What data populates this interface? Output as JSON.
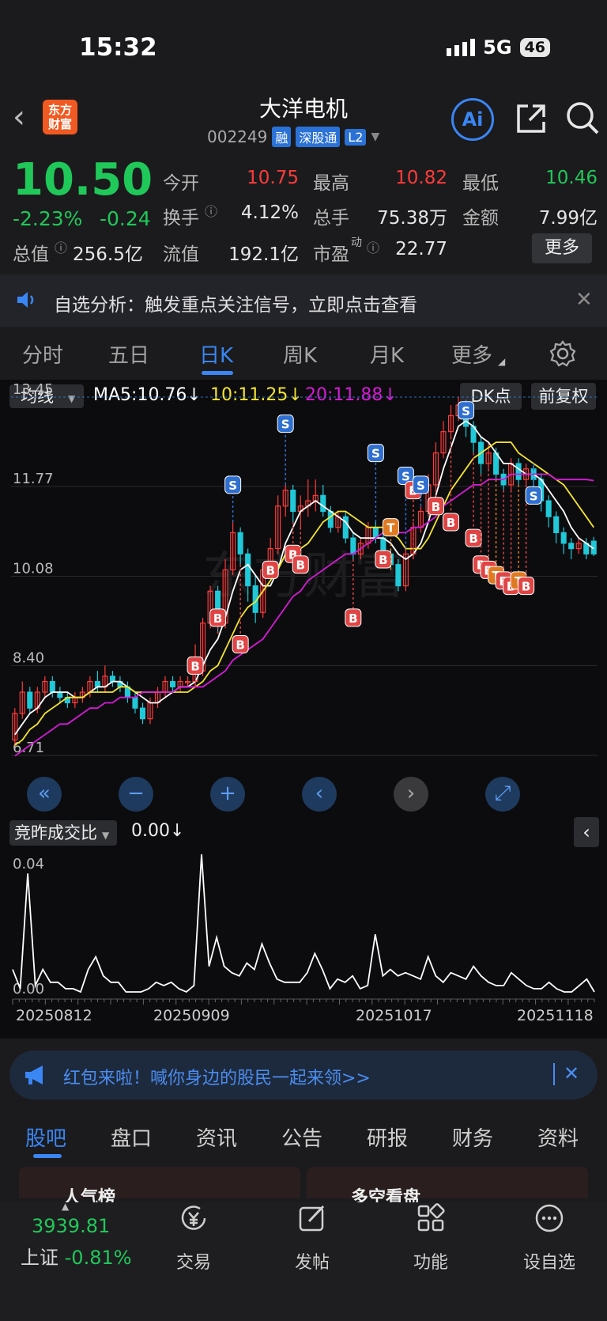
{
  "status": {
    "time": "15:32",
    "network": "5G",
    "battery": "46"
  },
  "header": {
    "logo": "东方\n财富",
    "title": "大洋电机",
    "code": "002249",
    "tags": [
      "融",
      "深股通",
      "L2"
    ],
    "ai_label": "Ai"
  },
  "quote": {
    "price": "10.50",
    "change_pct": "-2.23%",
    "change": "-0.24",
    "open_label": "今开",
    "open": "10.75",
    "high_label": "最高",
    "high": "10.82",
    "low_label": "最低",
    "low": "10.46",
    "turnover_label": "换手",
    "turnover": "4.12%",
    "volume_label": "总手",
    "volume": "75.38万",
    "amount_label": "金额",
    "amount": "7.99亿",
    "mcap_label": "总值",
    "mcap": "256.5亿",
    "float_label": "流值",
    "float": "192.1亿",
    "pe_label": "市盈",
    "pe_sup": "动",
    "pe": "22.77",
    "more": "更多"
  },
  "notice": {
    "text": "自选分析：触发重点关注信号，立即点击查看"
  },
  "tabs": [
    "分时",
    "五日",
    "日K",
    "周K",
    "月K",
    "更多"
  ],
  "active_tab": "日K",
  "chart_header": {
    "ma_select": "均线",
    "ma5": "MA5:10.76↓",
    "ma10": "10:11.25↓",
    "ma20": "20:11.88↓",
    "dk": "DK点",
    "fq": "前复权"
  },
  "colors": {
    "up": "#ff3b3b",
    "down": "#20c8d8",
    "ma5": "#ffffff",
    "ma10": "#f5e52a",
    "ma20": "#d81ad8",
    "accent": "#3a86f4",
    "green": "#20c85a"
  },
  "chart_data": {
    "type": "candlestick",
    "price_axis_labels": [
      "13.45",
      "11.77",
      "10.08",
      "8.40",
      "6.71"
    ],
    "ylim": [
      6.71,
      13.45
    ],
    "candles": [
      [
        7.0,
        7.5,
        6.9,
        7.6
      ],
      [
        7.5,
        7.9,
        7.4,
        8.1
      ],
      [
        7.9,
        7.6,
        7.5,
        8.0
      ],
      [
        7.6,
        7.9,
        7.5,
        8.0
      ],
      [
        7.9,
        8.1,
        7.8,
        8.2
      ],
      [
        8.1,
        7.9,
        7.8,
        8.2
      ],
      [
        7.9,
        7.8,
        7.7,
        8.0
      ],
      [
        7.8,
        7.7,
        7.6,
        7.9
      ],
      [
        7.7,
        7.8,
        7.6,
        7.9
      ],
      [
        7.8,
        7.9,
        7.7,
        8.0
      ],
      [
        7.9,
        8.1,
        7.8,
        8.2
      ],
      [
        8.1,
        8.0,
        7.9,
        8.3
      ],
      [
        8.0,
        8.2,
        7.9,
        8.4
      ],
      [
        8.2,
        8.1,
        8.0,
        8.3
      ],
      [
        8.1,
        8.0,
        7.9,
        8.2
      ],
      [
        8.0,
        7.8,
        7.7,
        8.1
      ],
      [
        7.8,
        7.6,
        7.5,
        7.9
      ],
      [
        7.6,
        7.4,
        7.3,
        7.7
      ],
      [
        7.4,
        7.7,
        7.3,
        7.8
      ],
      [
        7.7,
        7.9,
        7.6,
        8.0
      ],
      [
        7.9,
        8.1,
        7.8,
        8.2
      ],
      [
        8.1,
        8.0,
        7.9,
        8.2
      ],
      [
        8.0,
        8.1,
        7.9,
        8.2
      ],
      [
        8.1,
        8.1,
        8.0,
        8.2
      ],
      [
        8.1,
        8.3,
        8.0,
        8.8
      ],
      [
        8.3,
        9.2,
        8.2,
        9.3
      ],
      [
        9.2,
        9.8,
        9.1,
        9.9
      ],
      [
        9.8,
        9.2,
        9.0,
        9.9
      ],
      [
        9.2,
        10.2,
        9.1,
        10.4
      ],
      [
        10.2,
        10.9,
        10.1,
        11.1
      ],
      [
        10.9,
        10.5,
        10.3,
        11.0
      ],
      [
        10.5,
        9.9,
        9.6,
        10.6
      ],
      [
        9.9,
        9.4,
        9.2,
        10.1
      ],
      [
        9.4,
        10.2,
        9.3,
        10.3
      ],
      [
        10.2,
        10.6,
        10.1,
        10.8
      ],
      [
        10.6,
        11.4,
        10.5,
        11.6
      ],
      [
        11.4,
        11.7,
        11.2,
        11.8
      ],
      [
        11.7,
        11.3,
        11.1,
        11.8
      ],
      [
        11.3,
        11.4,
        11.0,
        11.6
      ],
      [
        11.4,
        11.5,
        11.2,
        11.9
      ],
      [
        11.5,
        11.6,
        11.3,
        11.9
      ],
      [
        11.6,
        11.3,
        11.2,
        11.8
      ],
      [
        11.3,
        11.0,
        10.9,
        11.4
      ],
      [
        11.0,
        11.2,
        10.9,
        11.3
      ],
      [
        11.2,
        10.8,
        10.7,
        11.3
      ],
      [
        10.8,
        10.5,
        10.4,
        10.9
      ],
      [
        10.5,
        10.7,
        10.4,
        10.8
      ],
      [
        10.7,
        11.0,
        10.6,
        11.1
      ],
      [
        11.0,
        10.8,
        10.7,
        11.1
      ],
      [
        10.8,
        10.5,
        10.4,
        10.9
      ],
      [
        10.5,
        10.3,
        10.2,
        10.6
      ],
      [
        10.3,
        9.9,
        9.8,
        10.4
      ],
      [
        9.9,
        10.5,
        9.8,
        10.6
      ],
      [
        10.5,
        11.0,
        10.4,
        11.1
      ],
      [
        11.0,
        11.3,
        10.9,
        11.4
      ],
      [
        11.3,
        11.8,
        11.2,
        12.0
      ],
      [
        11.8,
        12.4,
        11.7,
        12.6
      ],
      [
        12.4,
        12.8,
        12.3,
        13.0
      ],
      [
        12.8,
        13.1,
        12.7,
        13.3
      ],
      [
        13.1,
        13.3,
        13.0,
        13.45
      ],
      [
        13.3,
        12.9,
        12.7,
        13.4
      ],
      [
        12.9,
        12.6,
        12.4,
        13.0
      ],
      [
        12.6,
        12.2,
        12.0,
        12.7
      ],
      [
        12.2,
        12.4,
        12.1,
        12.6
      ],
      [
        12.4,
        12.0,
        11.9,
        12.5
      ],
      [
        12.0,
        11.8,
        11.7,
        12.1
      ],
      [
        11.8,
        12.2,
        11.7,
        12.3
      ],
      [
        12.2,
        11.9,
        11.8,
        12.3
      ],
      [
        11.9,
        12.1,
        11.8,
        12.2
      ],
      [
        12.1,
        11.9,
        11.7,
        12.2
      ],
      [
        11.9,
        11.5,
        11.3,
        12.0
      ],
      [
        11.5,
        11.2,
        11.0,
        11.6
      ],
      [
        11.2,
        10.9,
        10.7,
        11.3
      ],
      [
        10.9,
        10.7,
        10.5,
        11.0
      ],
      [
        10.7,
        10.6,
        10.4,
        10.8
      ],
      [
        10.6,
        10.7,
        10.5,
        10.8
      ],
      [
        10.7,
        10.5,
        10.4,
        10.8
      ],
      [
        10.74,
        10.5,
        10.46,
        10.82
      ]
    ],
    "ma5": [
      7.1,
      7.3,
      7.5,
      7.6,
      7.8,
      7.9,
      7.9,
      7.9,
      7.8,
      7.8,
      7.9,
      8.0,
      8.0,
      8.1,
      8.1,
      8.0,
      7.9,
      7.8,
      7.7,
      7.7,
      7.8,
      7.9,
      8.0,
      8.0,
      8.1,
      8.4,
      8.7,
      8.9,
      9.3,
      9.8,
      10.2,
      10.3,
      10.1,
      9.9,
      9.9,
      10.2,
      10.7,
      11.0,
      11.3,
      11.4,
      11.5,
      11.4,
      11.3,
      11.2,
      11.1,
      10.9,
      10.8,
      10.8,
      10.8,
      10.8,
      10.7,
      10.5,
      10.4,
      10.5,
      10.7,
      11.1,
      11.6,
      12.1,
      12.5,
      12.9,
      13.0,
      12.9,
      12.7,
      12.6,
      12.4,
      12.2,
      12.2,
      12.1,
      12.0,
      12.0,
      11.9,
      11.7,
      11.5,
      11.3,
      11.0,
      10.8,
      10.7,
      10.6
    ],
    "ma10": [
      6.9,
      7.0,
      7.2,
      7.3,
      7.5,
      7.6,
      7.7,
      7.8,
      7.8,
      7.8,
      7.9,
      7.9,
      7.9,
      7.9,
      8.0,
      8.0,
      7.9,
      7.9,
      7.9,
      7.9,
      7.9,
      7.9,
      7.9,
      7.9,
      8.0,
      8.1,
      8.3,
      8.4,
      8.7,
      9.0,
      9.3,
      9.5,
      9.6,
      9.8,
      10.0,
      10.2,
      10.5,
      10.6,
      10.6,
      10.7,
      10.9,
      11.1,
      11.2,
      11.3,
      11.3,
      11.2,
      11.1,
      11.0,
      11.0,
      11.0,
      10.9,
      10.8,
      10.6,
      10.6,
      10.6,
      10.8,
      11.1,
      11.4,
      11.7,
      11.9,
      12.1,
      12.3,
      12.4,
      12.5,
      12.6,
      12.6,
      12.6,
      12.4,
      12.3,
      12.2,
      12.1,
      12.0,
      11.9,
      11.8,
      11.6,
      11.4,
      11.2,
      11.0
    ],
    "ma20": [
      6.7,
      6.8,
      6.9,
      7.0,
      7.1,
      7.2,
      7.3,
      7.3,
      7.4,
      7.5,
      7.6,
      7.6,
      7.7,
      7.7,
      7.8,
      7.8,
      7.8,
      7.9,
      7.9,
      7.9,
      7.9,
      7.9,
      8.0,
      8.0,
      8.0,
      8.0,
      8.1,
      8.2,
      8.3,
      8.5,
      8.6,
      8.7,
      8.8,
      8.9,
      9.1,
      9.3,
      9.5,
      9.7,
      9.8,
      10.0,
      10.1,
      10.2,
      10.3,
      10.4,
      10.5,
      10.5,
      10.6,
      10.7,
      10.8,
      10.9,
      10.9,
      10.9,
      10.9,
      11.0,
      11.0,
      11.1,
      11.2,
      11.4,
      11.5,
      11.6,
      11.7,
      11.8,
      11.8,
      11.9,
      11.9,
      11.9,
      12.0,
      12.0,
      12.0,
      12.0,
      12.0,
      12.0,
      11.9,
      11.9,
      11.9,
      11.9,
      11.9,
      11.88
    ],
    "signals": [
      {
        "i": 24,
        "t": "B",
        "p": 8.4
      },
      {
        "i": 27,
        "t": "B",
        "p": 9.3
      },
      {
        "i": 29,
        "t": "S",
        "p": 11.8
      },
      {
        "i": 30,
        "t": "B",
        "p": 8.8
      },
      {
        "i": 34,
        "t": "B",
        "p": 10.2
      },
      {
        "i": 36,
        "t": "S",
        "p": 12.95
      },
      {
        "i": 37,
        "t": "B",
        "p": 10.5
      },
      {
        "i": 38,
        "t": "B",
        "p": 10.3
      },
      {
        "i": 45,
        "t": "B",
        "p": 9.3
      },
      {
        "i": 48,
        "t": "S",
        "p": 12.4
      },
      {
        "i": 49,
        "t": "B",
        "p": 10.4
      },
      {
        "i": 50,
        "t": "T",
        "p": 11.0
      },
      {
        "i": 52,
        "t": "S",
        "p": 11.97
      },
      {
        "i": 53,
        "t": "B",
        "p": 11.7
      },
      {
        "i": 54,
        "t": "S",
        "p": 11.8
      },
      {
        "i": 56,
        "t": "B",
        "p": 11.4
      },
      {
        "i": 58,
        "t": "B",
        "p": 11.1
      },
      {
        "i": 60,
        "t": "S",
        "p": 13.2
      },
      {
        "i": 61,
        "t": "B",
        "p": 10.8
      },
      {
        "i": 62,
        "t": "B",
        "p": 10.3
      },
      {
        "i": 63,
        "t": "B",
        "p": 10.2
      },
      {
        "i": 64,
        "t": "T",
        "p": 10.1
      },
      {
        "i": 65,
        "t": "B",
        "p": 10.0
      },
      {
        "i": 66,
        "t": "B",
        "p": 9.9
      },
      {
        "i": 67,
        "t": "T",
        "p": 10.0
      },
      {
        "i": 68,
        "t": "B",
        "p": 9.9
      },
      {
        "i": 69,
        "t": "S",
        "p": 11.6
      }
    ],
    "sub_label": "竞昨成交比",
    "sub_value": "0.00↓",
    "sub_axis": [
      "0.04",
      "0.00"
    ],
    "sub_series": [
      0.008,
      0.002,
      0.038,
      0.003,
      0.008,
      0.004,
      0.004,
      0.002,
      0.002,
      0.001,
      0.008,
      0.012,
      0.006,
      0.004,
      0.004,
      0.001,
      0.001,
      0.001,
      0.002,
      0.004,
      0.003,
      0.004,
      0.002,
      0.001,
      0.003,
      0.044,
      0.009,
      0.018,
      0.009,
      0.007,
      0.006,
      0.01,
      0.008,
      0.016,
      0.01,
      0.005,
      0.004,
      0.004,
      0.004,
      0.007,
      0.013,
      0.008,
      0.002,
      0.005,
      0.004,
      0.006,
      0.002,
      0.003,
      0.019,
      0.006,
      0.008,
      0.006,
      0.007,
      0.006,
      0.005,
      0.012,
      0.006,
      0.004,
      0.007,
      0.006,
      0.005,
      0.009,
      0.006,
      0.004,
      0.003,
      0.003,
      0.007,
      0.005,
      0.003,
      0.002,
      0.002,
      0.004,
      0.002,
      0.001,
      0.001,
      0.003,
      0.005,
      0.001
    ],
    "dates": [
      "20250812",
      "20250909",
      "20251017",
      "20251118"
    ]
  },
  "promo": {
    "text": "红包来啦！喊你身边的股民一起来领>>"
  },
  "bottom_tabs": [
    "股吧",
    "盘口",
    "资讯",
    "公告",
    "研报",
    "财务",
    "资料"
  ],
  "cards": [
    "人气榜",
    "多空看盘"
  ],
  "index": {
    "value": "3939.81",
    "name": "上证",
    "change": "-0.81%"
  },
  "nav": [
    "交易",
    "发帖",
    "功能",
    "设自选"
  ]
}
